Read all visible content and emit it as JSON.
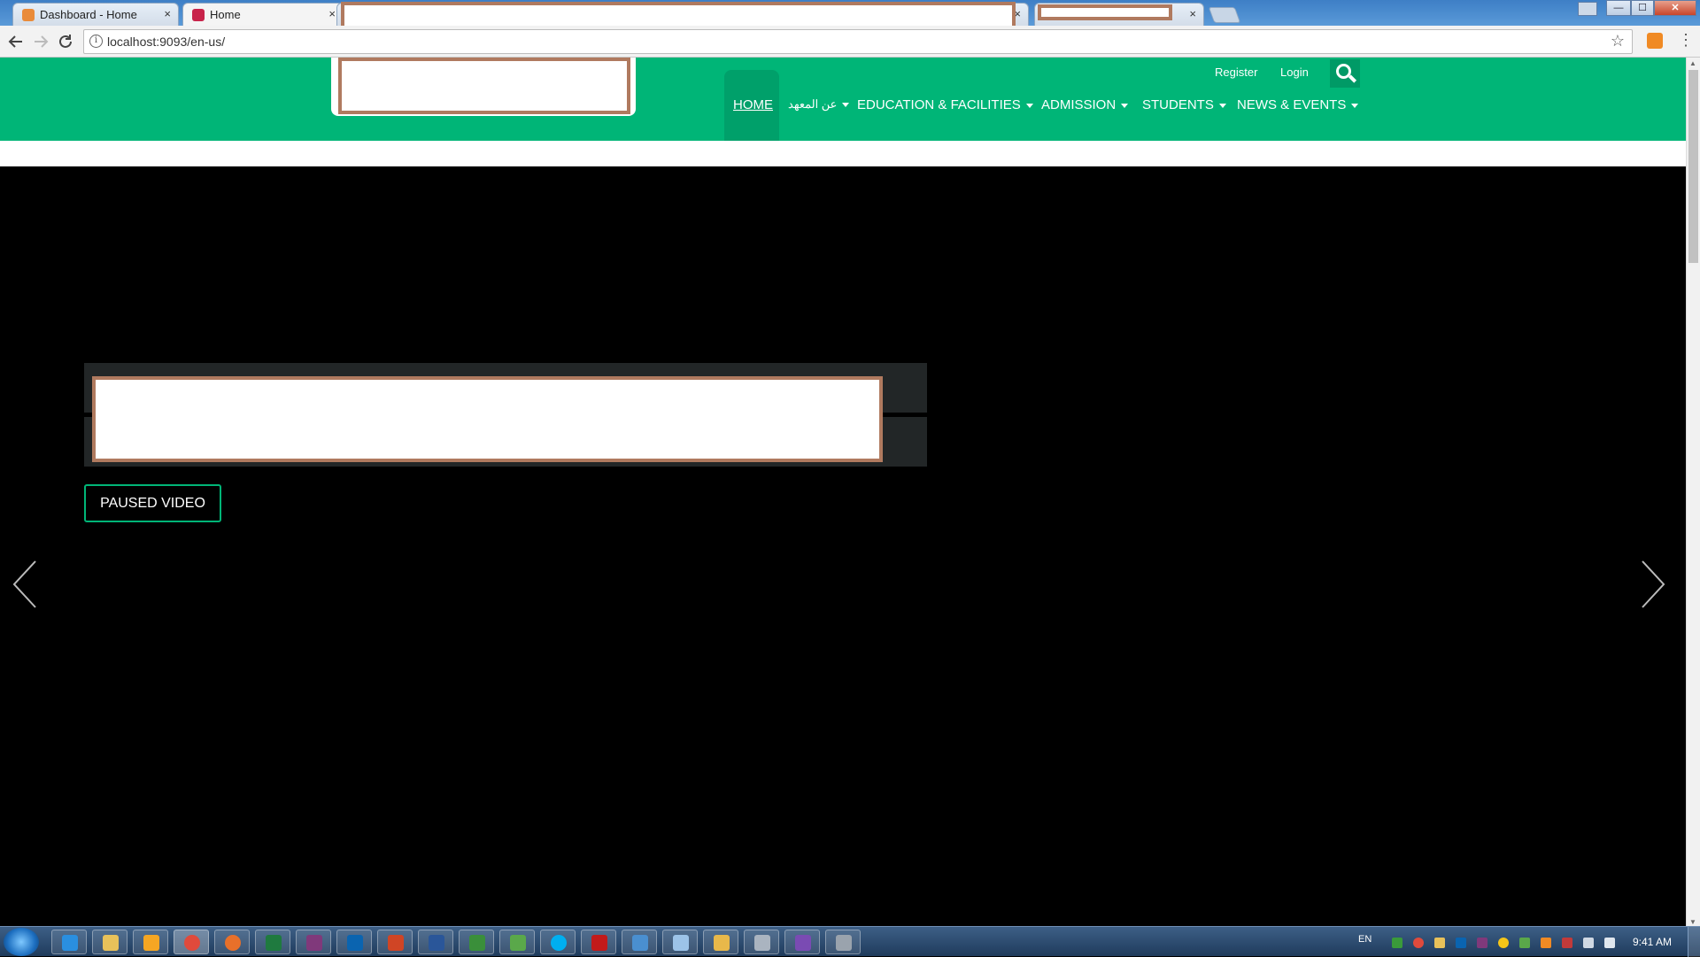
{
  "browser": {
    "tabs": [
      {
        "title": "Dashboard - Home",
        "close": "×"
      },
      {
        "title": "Home",
        "close": "×"
      },
      {
        "title": "",
        "close": "×"
      },
      {
        "title": "",
        "close": "×"
      }
    ],
    "window_controls": {
      "minimize": "—",
      "maximize": "☐",
      "close": "✕"
    },
    "address": {
      "url": "localhost:9093/en-us/",
      "info_glyph": "i"
    },
    "icons": {
      "back": "back-arrow-icon",
      "forward": "forward-arrow-icon",
      "reload": "reload-icon",
      "star": "bookmark-star-icon",
      "menu": "kebab-menu-icon"
    }
  },
  "site": {
    "top_links": {
      "register": "Register",
      "login": "Login"
    },
    "nav": [
      {
        "label": "HOME",
        "dropdown": false
      },
      {
        "label": "عن المعهد",
        "dropdown": true
      },
      {
        "label": "EDUCATION & FACILITIES",
        "dropdown": true
      },
      {
        "label": "ADMISSION",
        "dropdown": true
      },
      {
        "label": "STUDENTS",
        "dropdown": true
      },
      {
        "label": "NEWS & EVENTS",
        "dropdown": true
      }
    ],
    "hero": {
      "paused_button": "PAUSED VIDEO"
    },
    "colors": {
      "brand_green": "#00b577",
      "accent_dark_green": "#00a06a",
      "hero_bg": "#000000",
      "caption_bg": "#222627"
    }
  },
  "taskbar": {
    "language": "EN",
    "clock": "9:41 AM",
    "apps": [
      "internet-explorer",
      "file-explorer",
      "media-player",
      "chrome",
      "firefox",
      "excel",
      "onenote",
      "outlook",
      "powerpoint",
      "word",
      "project",
      "visio",
      "skype",
      "acrobat",
      "remote-desktop",
      "notepad",
      "paint",
      "tools",
      "visual-studio",
      "network"
    ]
  }
}
